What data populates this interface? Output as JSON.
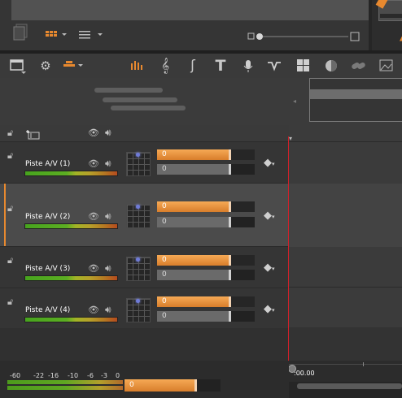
{
  "header": {
    "eye_icon": "eye-icon",
    "speaker_icon": "speaker-icon"
  },
  "tracks": [
    {
      "name": "Piste A/V (1)",
      "fader_value": "0",
      "volume_value": "0",
      "selected": false
    },
    {
      "name": "Piste A/V (2)",
      "fader_value": "0",
      "volume_value": "0",
      "selected": true
    },
    {
      "name": "Piste A/V (3)",
      "fader_value": "0",
      "volume_value": "0",
      "selected": false
    },
    {
      "name": "Piste A/V (4)",
      "fader_value": "0",
      "volume_value": "0",
      "selected": false
    }
  ],
  "master": {
    "scale": [
      "-60",
      "-22",
      "-16",
      "-10",
      "-6",
      "-3",
      "0"
    ],
    "fader_value": "0"
  },
  "timeline": {
    "time_label": ":00.00"
  },
  "colors": {
    "accent": "#e8892f",
    "playhead": "#d0202a",
    "selected_track": "#4b4b4b"
  },
  "icons": [
    "view-mode-icon",
    "settings-icon",
    "track-edit-icon",
    "audio-meter-icon",
    "music-icon",
    "sound-effect-icon",
    "title-icon",
    "voiceover-icon",
    "audio-ducking-icon",
    "grid-icon",
    "color-icon",
    "link-icon",
    "panoramic-icon"
  ]
}
